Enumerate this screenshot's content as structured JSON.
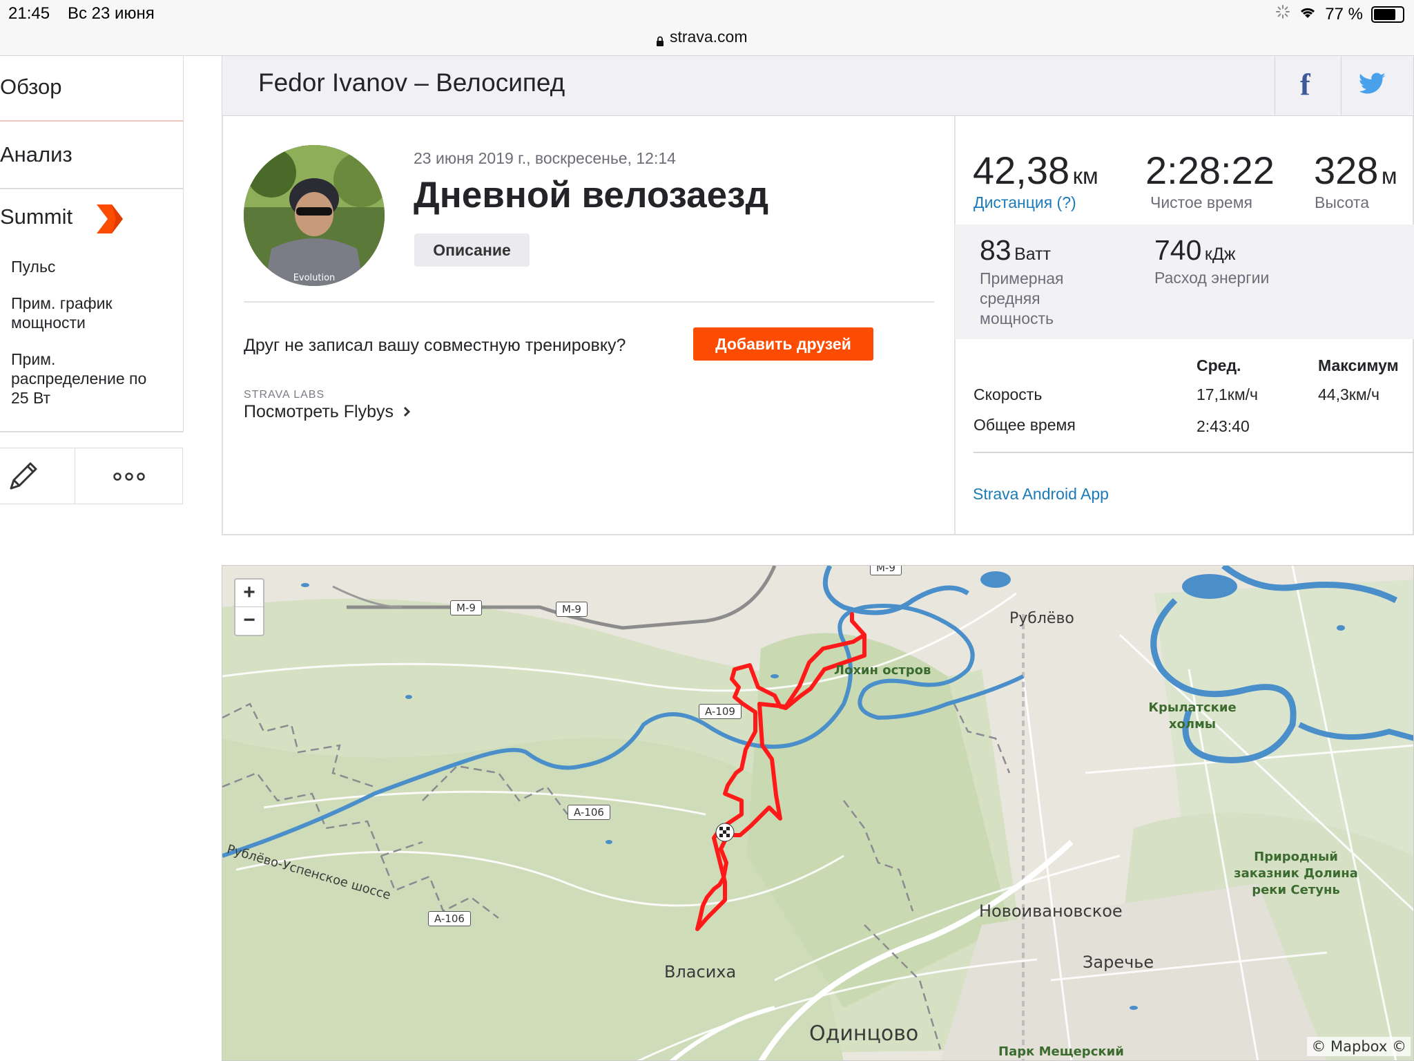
{
  "status_bar": {
    "time": "21:45",
    "date": "Вс 23 июня",
    "url": "strava.com",
    "battery": "77 %",
    "battery_level": 0.77
  },
  "sidebar": {
    "items": [
      {
        "label": "Обзор"
      },
      {
        "label": "Анализ"
      },
      {
        "label": "Summit"
      }
    ],
    "sub_items": [
      {
        "label": "Пульс"
      },
      {
        "label": "Прим. график мощности"
      },
      {
        "label": "Прим. распределение по 25 Вт"
      }
    ],
    "edit_icon": "pencil-icon",
    "more_icon": "more-dots-icon"
  },
  "header": {
    "title": "Fedor Ivanov – Велосипед",
    "share_facebook": "f",
    "share_twitter": "twitter-icon"
  },
  "activity": {
    "datetime": "23 июня 2019 г., воскресенье, 12:14",
    "name": "Дневной велозаезд",
    "description_button": "Описание",
    "friend_prompt": "Друг не записал вашу совместную тренировку?",
    "add_friends_button": "Добавить друзей",
    "labs_caption": "STRAVA LABS",
    "flybys_link": "Посмотреть Flybys"
  },
  "stats": {
    "distance": {
      "value": "42,38",
      "unit": "км",
      "label": "Дистанция (?)"
    },
    "moving_time": {
      "value": "2:28:22",
      "label": "Чистое время"
    },
    "elevation": {
      "value": "328",
      "unit": "м",
      "label": "Высота"
    },
    "power": {
      "value": "83",
      "unit": "Ватт",
      "label": "Примерная средняя мощность"
    },
    "energy": {
      "value": "740",
      "unit": "кДж",
      "label": "Расход энергии"
    },
    "table": {
      "col_avg": "Сред.",
      "col_max": "Максимум",
      "rows": [
        {
          "label": "Скорость",
          "avg": "17,1км/ч",
          "max": "44,3км/ч"
        },
        {
          "label": "Общее время",
          "avg": "2:43:40",
          "max": ""
        }
      ]
    },
    "device": "Strava Android App"
  },
  "map": {
    "zoom_in": "+",
    "zoom_out": "−",
    "labels": {
      "rublevo": "Рублёво",
      "lokhin": "Лохин остров",
      "krylatskie": "Крылатские холмы",
      "zakaznik": "Природный заказник Долина реки Сетунь",
      "novoivanovskoe": "Новоивановское",
      "zarechye": "Заречье",
      "vlasikha": "Власиха",
      "odintsovo": "Одинцово",
      "park": "Парк Мещерский",
      "rublevo_uspenskoe": "Рублёво-Успенское шоссе",
      "m9a": "M-9",
      "m9b": "M-9",
      "m9c": "M-9",
      "a109": "A-109",
      "a106a": "A-106",
      "a106b": "A-106",
      "attribution": "© Mapbox ©"
    },
    "route_color": "#ff1a1a"
  }
}
